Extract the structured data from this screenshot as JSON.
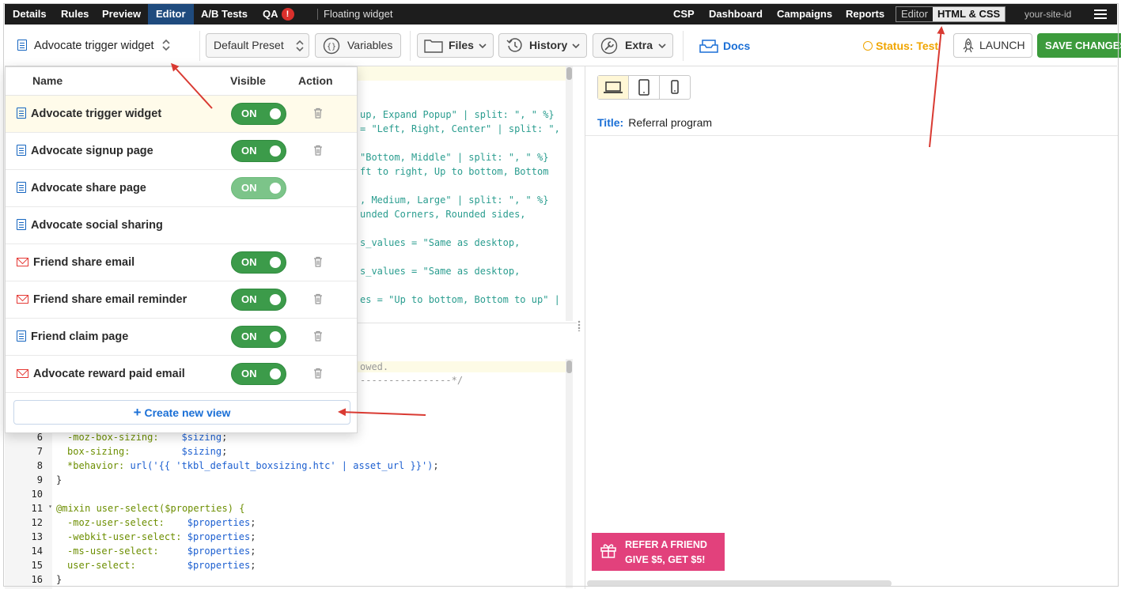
{
  "topnav": {
    "tabs": [
      {
        "label": "Details"
      },
      {
        "label": "Rules"
      },
      {
        "label": "Preview"
      },
      {
        "label": "Editor",
        "active": true
      },
      {
        "label": "A/B Tests"
      },
      {
        "label": "QA",
        "badge": "!"
      }
    ],
    "context_title": "Floating widget",
    "right_links": [
      "CSP",
      "Dashboard",
      "Campaigns",
      "Reports"
    ],
    "mode_toggle": {
      "editor": "Editor",
      "html_css": "HTML & CSS",
      "selected": "HTML & CSS"
    },
    "site_id": "your-site-id"
  },
  "toolbar": {
    "view_selector": "Advocate trigger widget",
    "preset_selector": "Default Preset",
    "variables": "Variables",
    "files": "Files",
    "history": "History",
    "extra": "Extra",
    "docs": "Docs",
    "status": "Status: Test",
    "launch": "LAUNCH",
    "save": "SAVE CHANGES"
  },
  "dropdown": {
    "headers": {
      "name": "Name",
      "visible": "Visible",
      "action": "Action"
    },
    "rows": [
      {
        "name": "Advocate trigger widget",
        "icon": "page-icon",
        "visible": "ON",
        "deletable": true,
        "highlighted": true
      },
      {
        "name": "Advocate signup page",
        "icon": "page-icon",
        "visible": "ON",
        "deletable": true
      },
      {
        "name": "Advocate share page",
        "icon": "page-icon",
        "visible": "ON",
        "deletable": false
      },
      {
        "name": "Advocate social sharing",
        "icon": "page-icon",
        "visible": null,
        "deletable": false
      },
      {
        "name": "Friend share email",
        "icon": "email-icon",
        "visible": "ON",
        "deletable": true
      },
      {
        "name": "Friend share email reminder",
        "icon": "email-icon",
        "visible": "ON",
        "deletable": true
      },
      {
        "name": "Friend claim page",
        "icon": "page-icon",
        "visible": "ON",
        "deletable": true
      },
      {
        "name": "Advocate reward paid email",
        "icon": "email-icon",
        "visible": "ON",
        "deletable": true
      }
    ],
    "create_button": "Create new view"
  },
  "code_top_fragments": [
    "up, Expand Popup\" | split: \", \" %}",
    "= \"Left, Right, Center\" | split: \",",
    "\"Bottom, Middle\" | split: \", \" %}",
    "ft to right, Up to bottom, Bottom",
    ", Medium, Large\" | split: \", \" %}",
    "unded Corners, Rounded sides,",
    "s_values = \"Same as desktop,",
    "s_values = \"Same as desktop,",
    "es = \"Up to bottom, Bottom to up\" |"
  ],
  "code_bottom_fragments": [
    "owed.",
    "----------------*/"
  ],
  "code_lines": [
    {
      "n": "6",
      "prop": "-moz-box-sizing:",
      "pad": "    ",
      "val": "$sizing",
      "end": ";"
    },
    {
      "n": "7",
      "prop": "box-sizing:",
      "pad": "         ",
      "val": "$sizing",
      "end": ";"
    },
    {
      "n": "8",
      "prop": "*behavior:",
      "pad": " ",
      "val": "url('{{ 'tkbl_default_boxsizing.htc' | asset_url }}')",
      "end": ";"
    },
    {
      "n": "9",
      "text": "}"
    },
    {
      "n": "10",
      "text": ""
    },
    {
      "n": "11",
      "mixin": "@mixin user-select($properties) {"
    },
    {
      "n": "12",
      "prop": "-moz-user-select:",
      "pad": "    ",
      "val": "$properties",
      "end": ";"
    },
    {
      "n": "13",
      "prop": "-webkit-user-select:",
      "pad": " ",
      "val": "$properties",
      "end": ";"
    },
    {
      "n": "14",
      "prop": "-ms-user-select:",
      "pad": "     ",
      "val": "$properties",
      "end": ";"
    },
    {
      "n": "15",
      "prop": "user-select:",
      "pad": "         ",
      "val": "$properties",
      "end": ";"
    },
    {
      "n": "16",
      "text": "}"
    }
  ],
  "preview": {
    "device_modes": [
      "desktop",
      "tablet",
      "mobile"
    ],
    "active_device": "desktop",
    "title_label": "Title:",
    "title_value": "Referral program",
    "widget": {
      "line1": "REFER A FRIEND",
      "line2": "GIVE $5, GET $5!"
    }
  },
  "colors": {
    "nav_bg": "#1d1d1d",
    "active_tab": "#1f4b7e",
    "accent_blue": "#1a6fd6",
    "toggle_on": "#3c9b4a",
    "save_green": "#3c9b3c",
    "status_amber": "#f0a500",
    "widget_pink": "#e2417c",
    "annotation_red": "#d93a32"
  }
}
